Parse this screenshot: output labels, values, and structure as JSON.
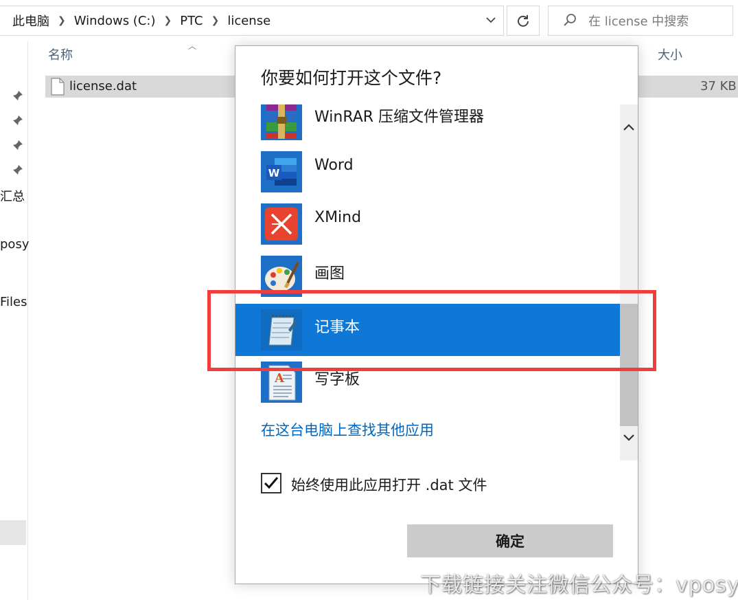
{
  "explorer": {
    "breadcrumb": [
      "此电脑",
      "Windows (C:)",
      "PTC",
      "license"
    ],
    "search_placeholder": "在 license 中搜索",
    "nav_items": [
      "汇总",
      "posy",
      "Files"
    ],
    "columns": {
      "name": "名称",
      "size": "大小"
    },
    "file": {
      "name": "license.dat",
      "size": "37 KB"
    }
  },
  "dialog": {
    "title": "你要如何打开这个文件?",
    "apps": [
      {
        "label": "WinRAR 压缩文件管理器",
        "icon": "winrar-icon"
      },
      {
        "label": "Word",
        "icon": "word-icon"
      },
      {
        "label": "XMind",
        "icon": "xmind-icon"
      },
      {
        "label": "画图",
        "icon": "paint-icon"
      },
      {
        "label": "记事本",
        "icon": "notepad-icon",
        "selected": true
      },
      {
        "label": "写字板",
        "icon": "wordpad-icon"
      }
    ],
    "more_apps_link": "在这台电脑上查找其他应用",
    "always_use": {
      "label": "始终使用此应用打开 .dat 文件",
      "checked": true
    },
    "ok_button": "确定"
  },
  "colors": {
    "selection": "#0f78d7",
    "link": "#0067c0",
    "highlight_box": "#f03d3d"
  },
  "watermark": "下载链接关注微信公众号：vposy"
}
